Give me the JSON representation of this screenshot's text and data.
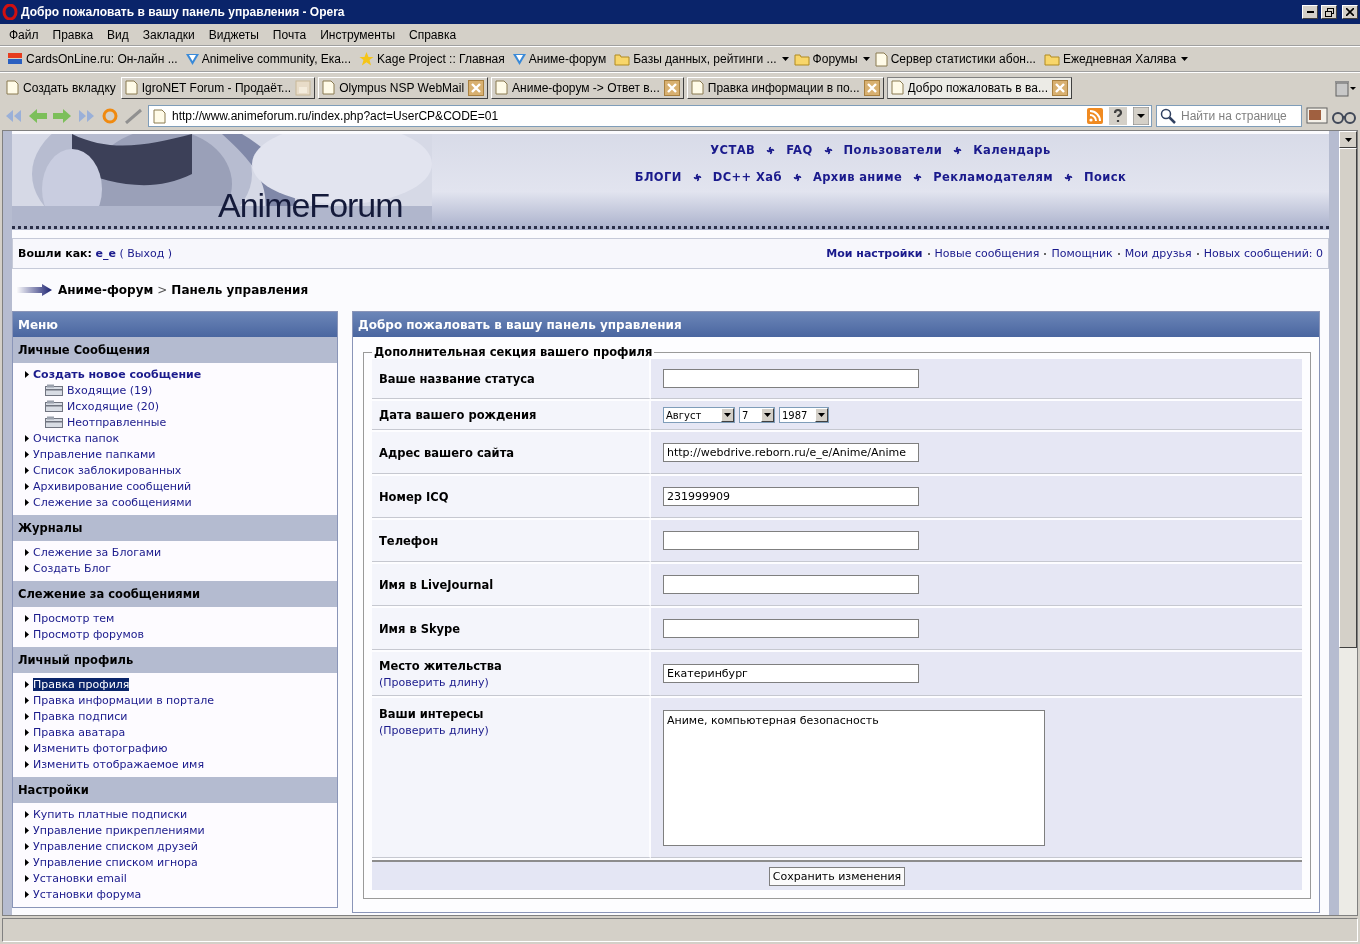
{
  "window": {
    "title": "Добро пожаловать в вашу панель управления - Opera"
  },
  "menu_bar": [
    "Файл",
    "Правка",
    "Вид",
    "Закладки",
    "Виджеты",
    "Почта",
    "Инструменты",
    "Справка"
  ],
  "bookmarks": [
    {
      "kind": "card",
      "label": "CardsOnLine.ru: Он-лайн ...",
      "has_menu": false
    },
    {
      "kind": "check",
      "label": "Animelive community, Ека...",
      "has_menu": false
    },
    {
      "kind": "star",
      "label": "Kage Project :: Главная",
      "has_menu": false
    },
    {
      "kind": "check",
      "label": "Аниме-форум",
      "has_menu": false
    },
    {
      "kind": "folder",
      "label": "Базы данных, рейтинги ...",
      "has_menu": true
    },
    {
      "kind": "folder",
      "label": "Форумы",
      "has_menu": true
    },
    {
      "kind": "page",
      "label": "Сервер статистики абон...",
      "has_menu": false
    },
    {
      "kind": "folder",
      "label": "Ежедневная Халява",
      "has_menu": true
    }
  ],
  "tab_bar": {
    "new_tab": "Создать вкладку",
    "tabs": [
      {
        "title": "IgroNET Forum - Продаёт...",
        "selected": false,
        "locked": true
      },
      {
        "title": "Olympus NSP WebMail",
        "selected": false,
        "locked": false
      },
      {
        "title": "Аниме-форум -> Ответ в...",
        "selected": false,
        "locked": false
      },
      {
        "title": "Правка информации в по...",
        "selected": false,
        "locked": false
      },
      {
        "title": "Добро пожаловать в ва...",
        "selected": true,
        "locked": false
      }
    ]
  },
  "address_bar": {
    "url": "http://www.animeforum.ru/index.php?act=UserCP&CODE=01",
    "search": {
      "placeholder": "Найти на странице"
    }
  },
  "site": {
    "logo": "AnimeForum",
    "nav": [
      [
        "УСТАВ",
        "FAQ",
        "Пользователи",
        "Календарь"
      ],
      [
        "БЛОГИ",
        "DC++ Хаб",
        "Архив аниме",
        "Рекламодателям",
        "Поиск"
      ]
    ],
    "user_bar": {
      "label": "Вошли как:",
      "user": "e_e",
      "logout": "( Выход )",
      "links": [
        {
          "label": "Мои настройки",
          "bold": true
        },
        {
          "label": "Новые сообщения",
          "bold": false
        },
        {
          "label": "Помощник",
          "bold": false
        },
        {
          "label": "Мои друзья",
          "bold": false
        },
        {
          "label": "Новых сообщений: 0",
          "bold": false
        }
      ]
    },
    "breadcrumb": {
      "parent": "Аниме-форум",
      "separator": ">",
      "current": "Панель управления"
    },
    "menu": {
      "title": "Меню",
      "sections": [
        {
          "title": "Личные Сообщения",
          "items": [
            {
              "kind": "primary",
              "label": "Создать новое сообщение",
              "selected": false
            },
            {
              "kind": "folder",
              "label": "Входящие (19)",
              "selected": false
            },
            {
              "kind": "folder",
              "label": "Исходящие (20)",
              "selected": false
            },
            {
              "kind": "folder",
              "label": "Неотправленные",
              "selected": false
            },
            {
              "kind": "link",
              "label": "Очистка папок",
              "selected": false
            },
            {
              "kind": "link",
              "label": "Управление папками",
              "selected": false
            },
            {
              "kind": "link",
              "label": "Список заблокированных",
              "selected": false
            },
            {
              "kind": "link",
              "label": "Архивирование сообщений",
              "selected": false
            },
            {
              "kind": "link",
              "label": "Слежение за сообщениями",
              "selected": false
            }
          ]
        },
        {
          "title": "Журналы",
          "items": [
            {
              "kind": "link",
              "label": "Слежение за Блогами",
              "selected": false
            },
            {
              "kind": "link",
              "label": "Создать Блог",
              "selected": false
            }
          ]
        },
        {
          "title": "Слежение за сообщениями",
          "items": [
            {
              "kind": "link",
              "label": "Просмотр тем",
              "selected": false
            },
            {
              "kind": "link",
              "label": "Просмотр форумов",
              "selected": false
            }
          ]
        },
        {
          "title": "Личный профиль",
          "items": [
            {
              "kind": "link",
              "label": "Правка профиля",
              "selected": true
            },
            {
              "kind": "link",
              "label": "Правка информации в портале",
              "selected": false
            },
            {
              "kind": "link",
              "label": "Правка подписи",
              "selected": false
            },
            {
              "kind": "link",
              "label": "Правка аватара",
              "selected": false
            },
            {
              "kind": "link",
              "label": "Изменить фотографию",
              "selected": false
            },
            {
              "kind": "link",
              "label": "Изменить отображаемое имя",
              "selected": false
            }
          ]
        },
        {
          "title": "Настройки",
          "items": [
            {
              "kind": "link",
              "label": "Купить платные подписки",
              "selected": false
            },
            {
              "kind": "link",
              "label": "Управление прикреплениями",
              "selected": false
            },
            {
              "kind": "link",
              "label": "Управление списком друзей",
              "selected": false
            },
            {
              "kind": "link",
              "label": "Управление списком игнора",
              "selected": false
            },
            {
              "kind": "link",
              "label": "Установки email",
              "selected": false
            },
            {
              "kind": "link",
              "label": "Установки форума",
              "selected": false
            }
          ]
        }
      ]
    },
    "panel": {
      "title": "Добро пожаловать в вашу панель управления",
      "legend": "Дополнительная секция вашего профиля",
      "rows": [
        {
          "kind": "text",
          "label": "Ваше название статуса"
        },
        {
          "kind": "date",
          "label": "Дата вашего рождения",
          "month": "Август",
          "day": "7",
          "year": "1987"
        },
        {
          "kind": "text",
          "label": "Адрес вашего сайта",
          "value": "http://webdrive.reborn.ru/e_e/Anime/Anime"
        },
        {
          "kind": "text",
          "label": "Номер ICQ",
          "value": "231999909"
        },
        {
          "kind": "text",
          "label": "Телефон"
        },
        {
          "kind": "text",
          "label": "Имя в LiveJournal"
        },
        {
          "kind": "text",
          "label": "Имя в Skype"
        },
        {
          "kind": "text",
          "label": "Место жительства",
          "hint": "(Проверить длину)",
          "value": "Екатеринбург"
        },
        {
          "kind": "textarea",
          "label": "Ваши интересы",
          "hint": "(Проверить длину)",
          "value": "Аниме, компьютерная безопасность"
        }
      ],
      "submit": "Сохранить изменения"
    }
  }
}
